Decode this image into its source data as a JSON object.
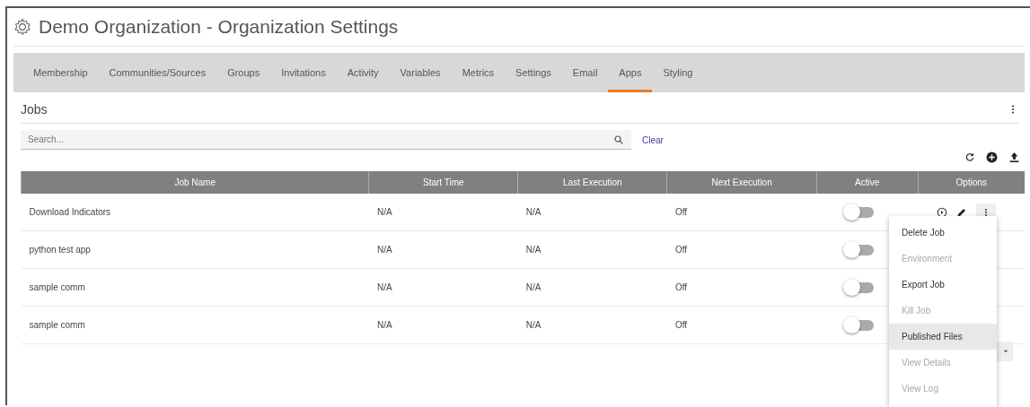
{
  "title": "Demo Organization - Organization Settings",
  "tabs": [
    {
      "label": "Membership",
      "selected": false
    },
    {
      "label": "Communities/Sources",
      "selected": false
    },
    {
      "label": "Groups",
      "selected": false
    },
    {
      "label": "Invitations",
      "selected": false
    },
    {
      "label": "Activity",
      "selected": false
    },
    {
      "label": "Variables",
      "selected": false
    },
    {
      "label": "Metrics",
      "selected": false
    },
    {
      "label": "Settings",
      "selected": false
    },
    {
      "label": "Email",
      "selected": false
    },
    {
      "label": "Apps",
      "selected": true
    },
    {
      "label": "Styling",
      "selected": false
    }
  ],
  "section_title": "Jobs",
  "search": {
    "placeholder": "Search...",
    "clear": "Clear"
  },
  "table": {
    "columns": [
      "Job Name",
      "Start Time",
      "Last Execution",
      "Next Execution",
      "Active",
      "Options"
    ],
    "rows": [
      {
        "name": "Download Indicators",
        "start_time": "N/A",
        "last_execution": "N/A",
        "next_execution": "Off",
        "active": false,
        "options": [
          {
            "kind": "play"
          },
          {
            "kind": "edit"
          },
          {
            "kind": "more"
          }
        ]
      },
      {
        "name": "python test app",
        "start_time": "N/A",
        "last_execution": "N/A",
        "next_execution": "Off",
        "active": false
      },
      {
        "name": "sample comm",
        "start_time": "N/A",
        "last_execution": "N/A",
        "next_execution": "Off",
        "active": false
      },
      {
        "name": "sample comm",
        "start_time": "N/A",
        "last_execution": "N/A",
        "next_execution": "Off",
        "active": false
      }
    ]
  },
  "menu": [
    {
      "label": "Delete Job",
      "disabled": false,
      "highlighted": false
    },
    {
      "label": "Environment",
      "disabled": true,
      "highlighted": false
    },
    {
      "label": "Export Job",
      "disabled": false,
      "highlighted": false
    },
    {
      "label": "Kill Job",
      "disabled": true,
      "highlighted": false
    },
    {
      "label": "Published Files",
      "disabled": false,
      "highlighted": true
    },
    {
      "label": "View Details",
      "disabled": true,
      "highlighted": false
    },
    {
      "label": "View Log",
      "disabled": true,
      "highlighted": false
    }
  ]
}
